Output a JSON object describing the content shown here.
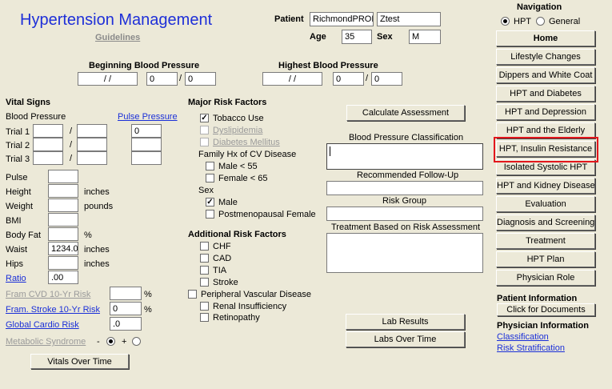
{
  "header": {
    "title": "Hypertension Management",
    "guidelines": "Guidelines",
    "patient_label": "Patient",
    "patient_first": "RichmondPROD",
    "patient_last": "Ztest",
    "age_label": "Age",
    "age_value": "35",
    "sex_label": "Sex",
    "sex_value": "M"
  },
  "bp": {
    "beginning_label": "Beginning Blood Pressure",
    "beginning_date": "/ /",
    "beginning_sys": "0",
    "beginning_dia": "0",
    "highest_label": "Highest Blood Pressure",
    "highest_date": "/ /",
    "highest_sys": "0",
    "highest_dia": "0",
    "slash": "/"
  },
  "vitals": {
    "heading": "Vital Signs",
    "blood_pressure": "Blood Pressure",
    "pulse_pressure": "Pulse Pressure",
    "trials": [
      {
        "label": "Trial 1",
        "pp": "0"
      },
      {
        "label": "Trial 2",
        "pp": ""
      },
      {
        "label": "Trial 3",
        "pp": ""
      }
    ],
    "pulse": "Pulse",
    "height": "Height",
    "height_unit": "inches",
    "weight": "Weight",
    "weight_unit": "pounds",
    "bmi": "BMI",
    "body_fat": "Body Fat",
    "body_fat_unit": "%",
    "waist": "Waist",
    "waist_value": "1234.0",
    "waist_unit": "inches",
    "hips": "Hips",
    "hips_unit": "inches",
    "ratio": "Ratio",
    "ratio_value": ".00",
    "fram_cvd": "Fram CVD 10-Yr Risk",
    "fram_cvd_unit": "%",
    "fram_stroke": "Fram. Stroke 10-Yr Risk",
    "fram_stroke_value": "0",
    "fram_stroke_unit": "%",
    "global_cardio": "Global Cardio Risk",
    "global_cardio_value": ".0",
    "metabolic": "Metabolic Syndrome",
    "minus": "-",
    "plus": "+",
    "vitals_over_time": "Vitals Over Time"
  },
  "risk": {
    "heading": "Major Risk Factors",
    "tobacco": "Tobacco Use",
    "dyslipidemia": "Dyslipidemia",
    "diabetes": "Diabetes Mellitus",
    "family_hx": "Family Hx of CV Disease",
    "male55": "Male < 55",
    "female65": "Female < 65",
    "sex": "Sex",
    "male": "Male",
    "postmeno": "Postmenopausal Female",
    "additional_heading": "Additional Risk Factors",
    "chf": "CHF",
    "cad": "CAD",
    "tia": "TIA",
    "stroke": "Stroke",
    "pvd": "Peripheral Vascular Disease",
    "renal": "Renal Insufficiency",
    "retino": "Retinopathy"
  },
  "assessment": {
    "calculate": "Calculate Assessment",
    "bp_class": "Blood Pressure Classification",
    "followup": "Recommended Follow-Up",
    "risk_group": "Risk Group",
    "treatment": "Treatment Based on Risk Assessment",
    "lab_results": "Lab Results",
    "labs_over_time": "Labs Over Time"
  },
  "nav": {
    "heading": "Navigation",
    "hpt": "HPT",
    "general": "General",
    "items": [
      "Home",
      "Lifestyle Changes",
      "Dippers and White Coat",
      "HPT and Diabetes",
      "HPT and Depression",
      "HPT and the Elderly",
      "HPT,  Insulin Resistance",
      "Isolated Systolic HPT",
      "HPT and Kidney Disease",
      "Evaluation",
      "Diagnosis and Screening",
      "Treatment",
      "HPT Plan",
      "Physician Role"
    ],
    "patient_info": "Patient Information",
    "documents": "Click for Documents",
    "physician_info": "Physician Information",
    "classification": "Classification",
    "risk_strat": "Risk Stratification"
  }
}
